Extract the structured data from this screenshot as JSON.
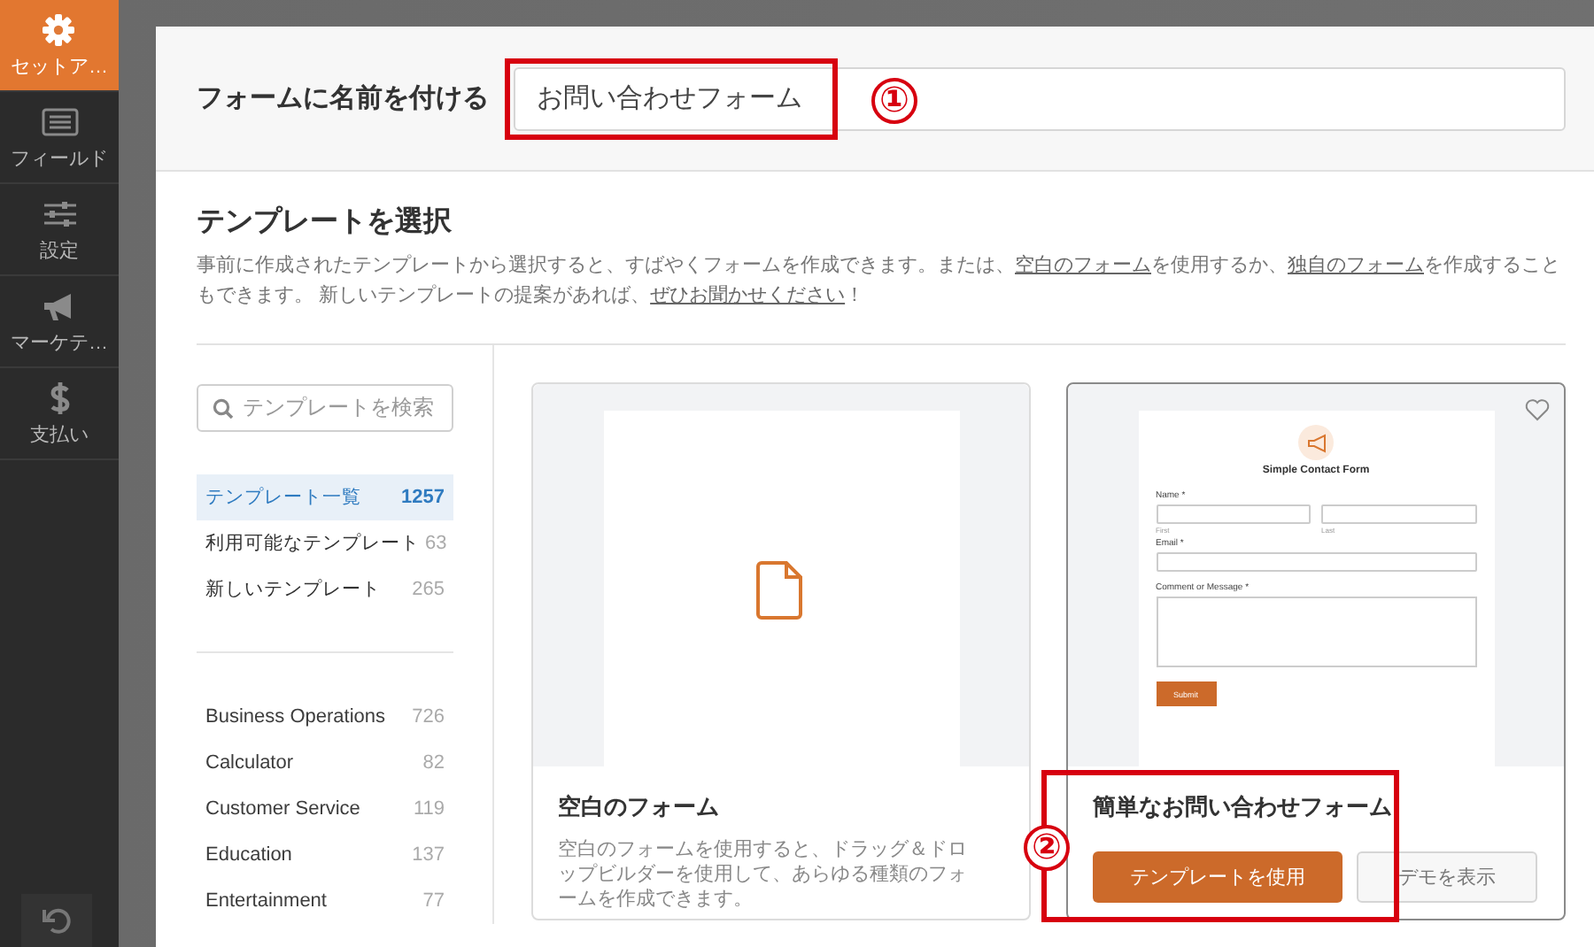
{
  "sidebar": {
    "items": [
      {
        "label": "セットア…",
        "selected": true
      },
      {
        "label": "フィールド",
        "selected": false
      },
      {
        "label": "設定",
        "selected": false
      },
      {
        "label": "マーケテ…",
        "selected": false
      },
      {
        "label": "支払い",
        "selected": false
      }
    ]
  },
  "form_name": {
    "label": "フォームに名前を付ける",
    "value": "お問い合わせフォーム"
  },
  "template_section": {
    "title": "テンプレートを選択",
    "description": [
      {
        "kind": "text",
        "text": "事前に作成されたテンプレートから選択すると、すばやくフォームを作成できます。または、"
      },
      {
        "kind": "link",
        "text": "空白のフォーム"
      },
      {
        "kind": "text",
        "text": "を使用するか、"
      },
      {
        "kind": "link",
        "text": "独自のフォーム"
      },
      {
        "kind": "text",
        "text": "を作成することもできます。 新しいテンプレートの提案があれば、"
      },
      {
        "kind": "link",
        "text": "ぜひお聞かせください"
      },
      {
        "kind": "text",
        "text": "！"
      }
    ]
  },
  "search": {
    "placeholder": "テンプレートを検索"
  },
  "collections": [
    {
      "label": "テンプレート一覧",
      "count": "1257",
      "selected": true
    },
    {
      "label": "利用可能なテンプレート",
      "count": "63",
      "selected": false
    },
    {
      "label": "新しいテンプレート",
      "count": "265",
      "selected": false
    }
  ],
  "categories": [
    {
      "label": "Business Operations",
      "count": "726"
    },
    {
      "label": "Calculator",
      "count": "82"
    },
    {
      "label": "Customer Service",
      "count": "119"
    },
    {
      "label": "Education",
      "count": "137"
    },
    {
      "label": "Entertainment",
      "count": "77"
    }
  ],
  "cards": [
    {
      "kind": "blank",
      "title": "空白のフォーム",
      "description": "空白のフォームを使用すると、ドラッグ＆ドロップビルダーを使用して、あらゆる種類のフォームを作成できます。"
    },
    {
      "kind": "preview",
      "title": "簡単なお問い合わせフォーム",
      "favorite": false,
      "preview": {
        "title": "Simple Contact Form",
        "name_label": "Name *",
        "first": "First",
        "last": "Last",
        "email_label": "Email *",
        "message_label": "Comment or Message *",
        "submit": "Submit"
      },
      "buttons": [
        {
          "kind": "primary",
          "label": "テンプレートを使用"
        },
        {
          "kind": "secondary",
          "label": "デモを表示"
        }
      ]
    }
  ],
  "annotations": [
    {
      "kind": "name-field",
      "label": "①"
    },
    {
      "kind": "use-template",
      "label": "②"
    }
  ]
}
